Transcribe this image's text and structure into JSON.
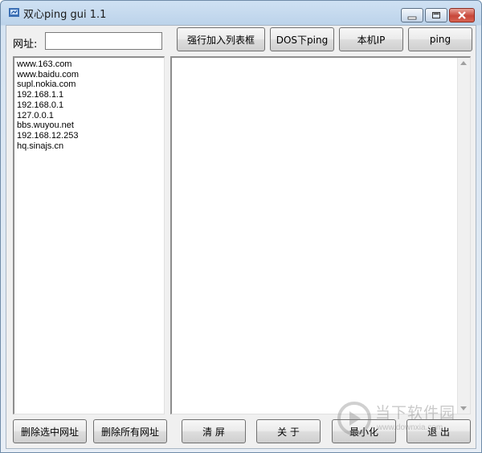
{
  "window": {
    "title": "双心ping gui 1.1",
    "icon": "app-icon"
  },
  "toolbar": {
    "url_label": "网址:",
    "url_value": "",
    "force_add_label": "强行加入列表框",
    "dos_ping_label": "DOS下ping",
    "local_ip_label": "本机IP",
    "ping_label": "ping"
  },
  "url_list": [
    "www.163.com",
    "www.baidu.com",
    "supl.nokia.com",
    "192.168.1.1",
    "192.168.0.1",
    "127.0.0.1",
    "bbs.wuyou.net",
    "192.168.12.253",
    "hq.sinajs.cn"
  ],
  "output": {
    "text": ""
  },
  "footer": {
    "delete_selected_label": "删除选中网址",
    "delete_all_label": "删除所有网址",
    "clear_label": "清  屏",
    "about_label": "关  于",
    "minimize_label": "最小化",
    "exit_label": "退  出"
  },
  "watermark": {
    "text": "当下软件园",
    "sub": "www.downxia.com"
  },
  "colors": {
    "titlebar": "#bcd3ea",
    "close_button": "#c7473a",
    "client_bg": "#f0f0f0"
  }
}
